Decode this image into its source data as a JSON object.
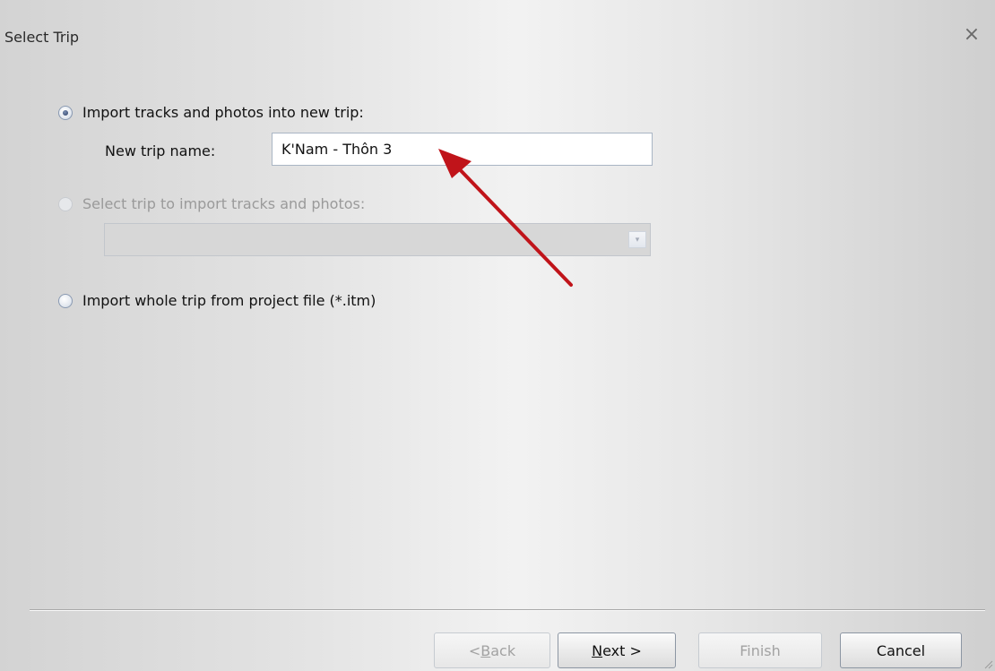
{
  "window": {
    "title": "Select Trip",
    "close_icon": "×"
  },
  "options": {
    "new_trip": {
      "label": "Import tracks and photos into new trip:",
      "checked": true
    },
    "new_trip_name": {
      "label": "New trip name:",
      "value": "K'Nam - Thôn 3"
    },
    "existing_trip": {
      "label": "Select trip to import tracks and photos:",
      "checked": false,
      "disabled": true
    },
    "existing_trip_select": {
      "value": "",
      "dropdown_icon": "▾"
    },
    "project_file": {
      "label": "Import whole trip from project file (*.itm)",
      "checked": false
    }
  },
  "buttons": {
    "back": {
      "prefix": "< ",
      "mnemonic": "B",
      "rest": "ack",
      "disabled": true
    },
    "next": {
      "mnemonic": "N",
      "rest": "ext >",
      "disabled": false
    },
    "finish": {
      "label": "Finish",
      "disabled": true
    },
    "cancel": {
      "label": "Cancel",
      "disabled": false
    }
  },
  "annotation": {
    "arrow_color": "#c0141a"
  }
}
